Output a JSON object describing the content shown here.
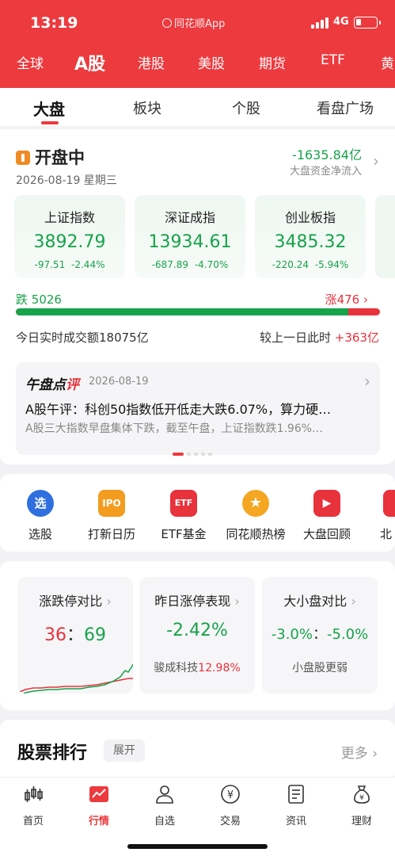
{
  "status_bar": {
    "time": "13:19",
    "app": "同花顺App",
    "network": "4G"
  },
  "market_tabs": [
    "全球",
    "A股",
    "港股",
    "美股",
    "期货",
    "ETF",
    "黄"
  ],
  "sub_tabs": [
    "大盘",
    "板块",
    "个股",
    "看盘广场"
  ],
  "overview": {
    "status": "开盘中",
    "date": "2026-08-19 星期三",
    "net_flow": "-1635.84亿",
    "net_flow_label": "大盘资金净流入",
    "indices": [
      {
        "name": "上证指数",
        "value": "3892.79",
        "change": "-97.51",
        "pct": "-2.44%"
      },
      {
        "name": "深证成指",
        "value": "13934.61",
        "change": "-687.89",
        "pct": "-4.70%"
      },
      {
        "name": "创业板指",
        "value": "3485.32",
        "change": "-220.24",
        "pct": "-5.94%"
      }
    ],
    "fall_label": "跌",
    "fall_count": "5026",
    "rise_label": "涨",
    "rise_count": "476",
    "fall_ratio": 0.913,
    "turnover": "今日实时成交额18075亿",
    "compare_label": "较上一日此时",
    "compare_value": "+363亿"
  },
  "news": {
    "logo_a": "午盘点",
    "logo_b": "评",
    "date": "2026-08-19",
    "title": "A股午评：科创50指数低开低走大跌6.07%，算力硬…",
    "summary": "A股三大指数早盘集体下跌，截至午盘，上证指数跌1.96%…"
  },
  "tools": [
    {
      "label": "选股",
      "icon": "选"
    },
    {
      "label": "打新日历",
      "icon": "IPO"
    },
    {
      "label": "ETF基金",
      "icon": "ETF"
    },
    {
      "label": "同花顺热榜",
      "icon": "star"
    },
    {
      "label": "大盘回顾",
      "icon": "play"
    },
    {
      "label": "北",
      "icon": "tag"
    }
  ],
  "compare_cards": [
    {
      "title": "涨跌停对比",
      "up": "36",
      "sep": "：",
      "down": "69"
    },
    {
      "title": "昨日涨停表现",
      "value": "-2.42%",
      "note": "骏成科技",
      "note_value": "12.98%"
    },
    {
      "title": "大小盘对比",
      "value_a": "-3.0%",
      "sep": "：",
      "value_b": "-5.0%",
      "note": "小盘股更弱"
    }
  ],
  "ranking": {
    "title": "股票排行",
    "expand": "展开",
    "more": "更多"
  },
  "bottom_nav": [
    "首页",
    "行情",
    "自选",
    "交易",
    "资讯",
    "理财"
  ],
  "colors": {
    "brand_red": "#ec3a3e",
    "up_red": "#e8323c",
    "down_green": "#17a34a"
  }
}
